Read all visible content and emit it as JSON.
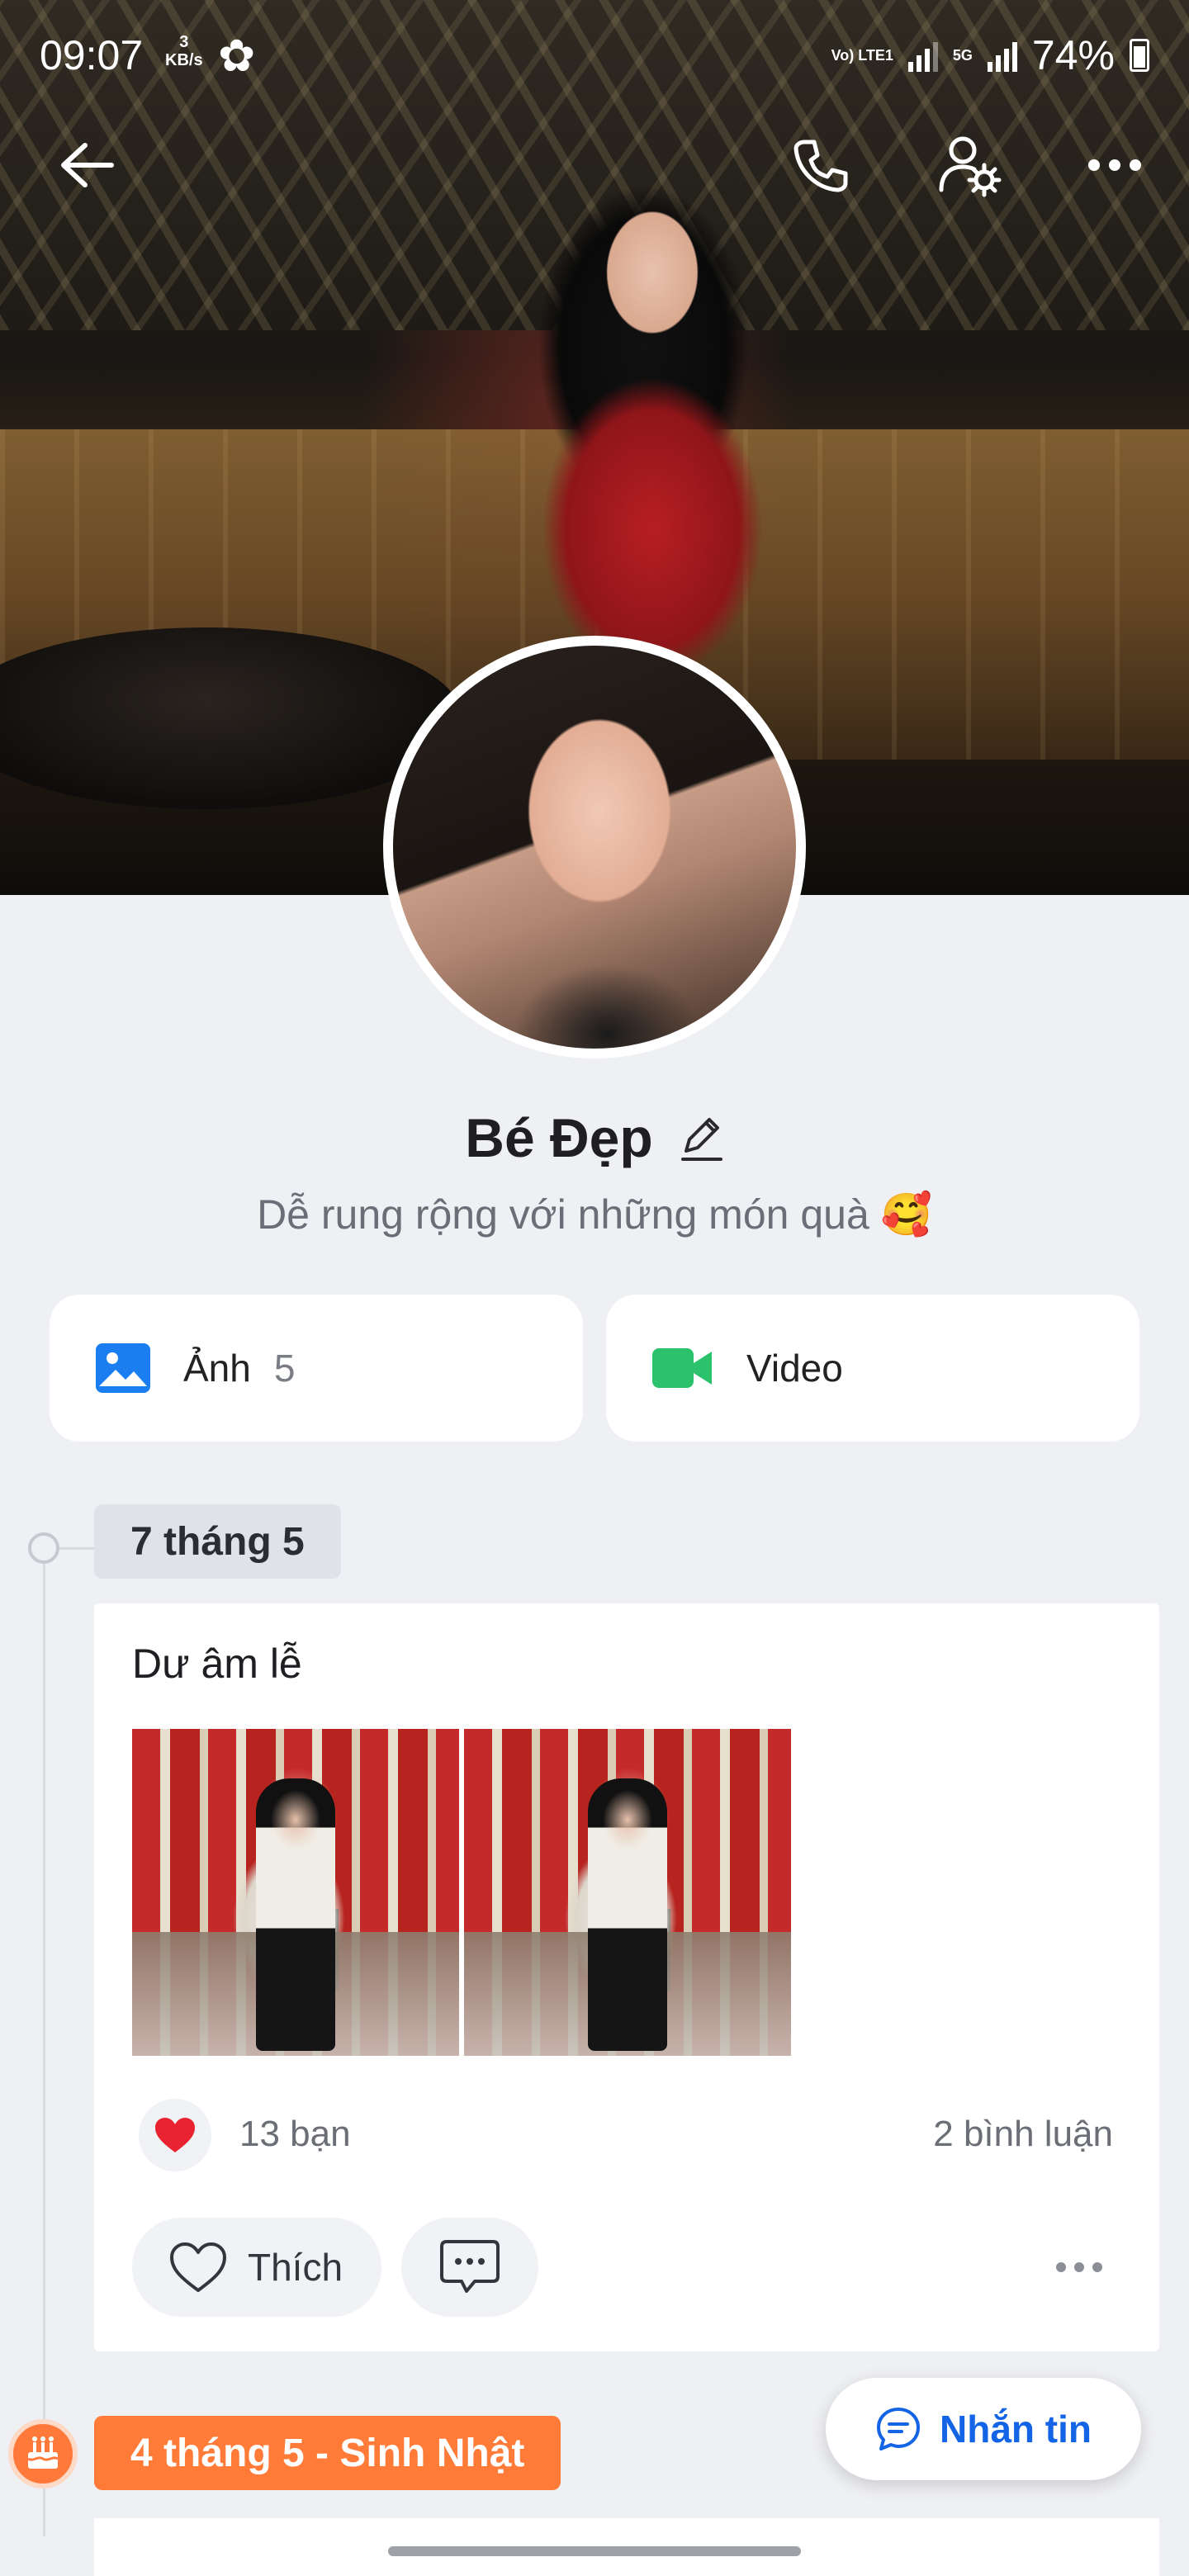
{
  "status_bar": {
    "time": "09:07",
    "net_speed_value": "3",
    "net_speed_unit": "KB/s",
    "net_tag_1": "Vo) LTE1",
    "net_tag_2": "5G",
    "battery": "74%"
  },
  "profile": {
    "name": "Bé Đẹp",
    "bio": "Dễ rung rộng với những món quà 🥰"
  },
  "media": {
    "photos_label": "Ảnh",
    "photos_count": "5",
    "video_label": "Video"
  },
  "timeline": [
    {
      "date": "7 tháng 5",
      "post_text": "Dư âm lễ",
      "reactions": "13 bạn",
      "comments": "2 bình luận",
      "like_label": "Thích"
    },
    {
      "date": "4 tháng 5 - Sinh Nhật"
    }
  ],
  "message_button": "Nhắn tin",
  "colors": {
    "accent_blue": "#1464e6",
    "video_green": "#2bc26b",
    "photo_blue": "#1a7df0",
    "birthday_orange": "#ff7b37",
    "heart_red": "#e8232f"
  }
}
